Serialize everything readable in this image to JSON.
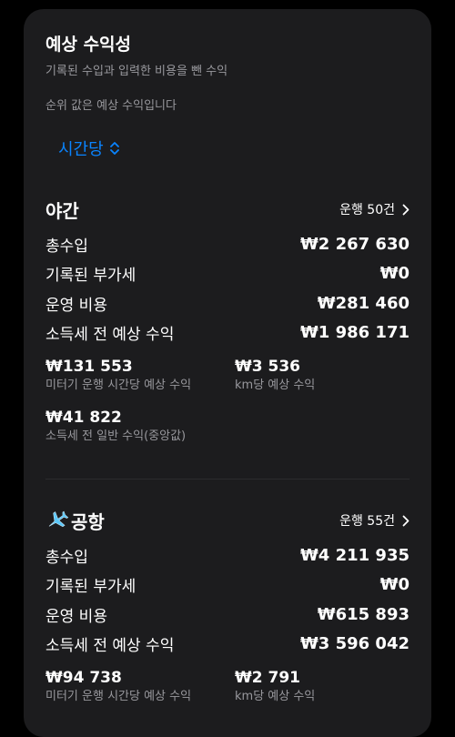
{
  "header": {
    "title": "예상 수익성",
    "subtitle": "기록된 수입과 입력한 비용을 뺀 수익",
    "note": "순위 값은 예상 수익입니다"
  },
  "period_selector": {
    "label": "시간당"
  },
  "colors": {
    "accent": "#0a84ff",
    "card_bg": "#1c1c1e",
    "secondary_text": "#98989d"
  },
  "sections": [
    {
      "title": "야간",
      "icon": "",
      "trips_label": "운행 50건",
      "rows": [
        {
          "label": "총수입",
          "value": "₩2 267 630"
        },
        {
          "label": "기록된 부가세",
          "value": "₩0"
        },
        {
          "label": "운영 비용",
          "value": "₩281 460"
        },
        {
          "label": "소득세 전 예상 수익",
          "value": "₩1 986 171"
        }
      ],
      "stats": [
        {
          "value": "₩131 553",
          "label": "미터기 운행 시간당 예상 수익"
        },
        {
          "value": "₩3 536",
          "label": "km당 예상 수익"
        },
        {
          "value": "₩41 822",
          "label": "소득세 전 일반 수익(중앙값)"
        }
      ]
    },
    {
      "title": "공항",
      "icon": "airplane-icon",
      "trips_label": "운행 55건",
      "rows": [
        {
          "label": "총수입",
          "value": "₩4 211 935"
        },
        {
          "label": "기록된 부가세",
          "value": "₩0"
        },
        {
          "label": "운영 비용",
          "value": "₩615 893"
        },
        {
          "label": "소득세 전 예상 수익",
          "value": "₩3 596 042"
        }
      ],
      "stats": [
        {
          "value": "₩94 738",
          "label": "미터기 운행 시간당 예상 수익"
        },
        {
          "value": "₩2 791",
          "label": "km당 예상 수익"
        }
      ]
    }
  ]
}
